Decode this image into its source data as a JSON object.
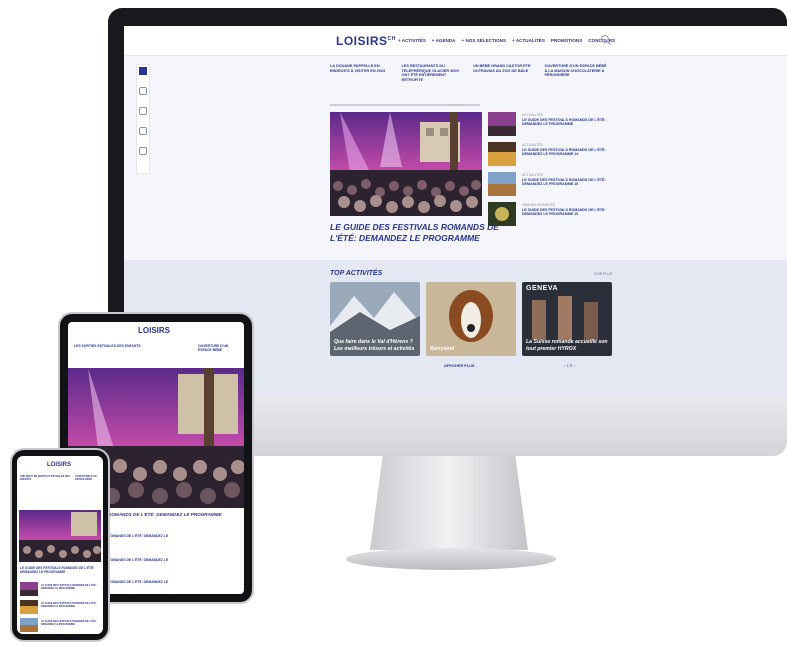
{
  "brand": {
    "logo": "LOISIRS",
    "logo_sup": "CH",
    "accent": "#2a3591",
    "band": "#e3e8f3"
  },
  "nav": {
    "items": [
      "+ ACTIVITÉS",
      "+ AGENDA",
      "+ NOS SÉLECTIONS",
      "+ ACTUALITÉS",
      "PROMOTIONS",
      "CONCOURS"
    ]
  },
  "news": [
    "LA DOUANE PAPPELLE EN ENDROITS À VISITER EN 2023",
    "LES RESTAURANTS DU TÉLÉPHÉRIQUE GLACIER 3000 ONT ÉTÉ ENTIÈREMENT RÉTROFITÉ",
    "UN BÉBÉ GRAND CASTOR ÉTÉ OUTRAVAIS AU ZOO DE BÂLE",
    "OUVERTURE D'UN ESPACE BÉBÉ À LA MAISON CHOCOLATERIE À PÉRONNIÈRE"
  ],
  "hero": {
    "title": "LE GUIDE DES FESTIVALS ROMANDS DE L'ÉTÉ: DEMANDEZ LE PROGRAMME"
  },
  "side_items": [
    {
      "tag": "ACTUALITÉS",
      "text": "LE GUIDE DES FESTIVALS ROMANDS DE L'ÉTÉ: DEMANDEZ LE PROGRAMME"
    },
    {
      "tag": "ACTUALITÉS",
      "text": "LE GUIDE DES FESTIVALS ROMANDS DE L'ÉTÉ: DEMANDEZ LE PROGRAMME 14"
    },
    {
      "tag": "ACTUALITÉS",
      "text": "LE GUIDE DES FESTIVALS ROMANDS DE L'ÉTÉ: DEMANDEZ LE PROGRAMME 15"
    },
    {
      "tag": "GRANDS MOMENTS",
      "text": "LE GUIDE DES FESTIVALS ROMANDS DE L'ÉTÉ: DEMANDEZ LE PROGRAMME 15"
    }
  ],
  "top": {
    "title": "TOP ACTIVITÉS",
    "more": "VOIR PLUS",
    "cards": [
      "Que faire dans le Val d'Hérens ? Les meilleurs trésors et activités",
      "Barryland",
      "La Suisse romande accueille son tout premier HYROX"
    ],
    "geneva": "GENEVA",
    "show_more": "AFFICHER PLUS",
    "pager": "‹  1/3  ›"
  },
  "tablet": {
    "logo": "LOISIRS",
    "news_left": "LES SORTIES ESTIVALES DES ENFANTS",
    "news_right": "OUVERTURE D'UN ESPACE BÉBÉ",
    "title": "ROMANDS DE L'ÉTÉ: DEMANDEZ LE PROGRAMME",
    "list": [
      "ROMANDS DE L'ÉTÉ: DEMANDEZ LE",
      "ROMANDS DE L'ÉTÉ: DEMANDEZ LE",
      "ROMANDS DE L'ÉTÉ: DEMANDEZ LE"
    ]
  },
  "phone": {
    "logo": "LOISIRS",
    "news_left": "UNE DROIT DE SORTIE ET ESTIVALES DES ENFANTS",
    "news_right": "OUVERTURE D'UN ESPACE BÉBÉ",
    "title": "LE GUIDE DES FESTIVALS ROMANDS DE L'ÉTÉ: DEMANDEZ LE PROGRAMME",
    "items": [
      "LE GUIDE DES FESTIVALS ROMANDS DE L'ÉTÉ: DEMANDEZ LE PROGRAMME",
      "LE GUIDE DES FESTIVALS ROMANDS DE L'ÉTÉ: DEMANDEZ LE PROGRAMME",
      "LE GUIDE DES FESTIVALS ROMANDS DE L'ÉTÉ: DEMANDEZ LE PROGRAMME"
    ]
  }
}
